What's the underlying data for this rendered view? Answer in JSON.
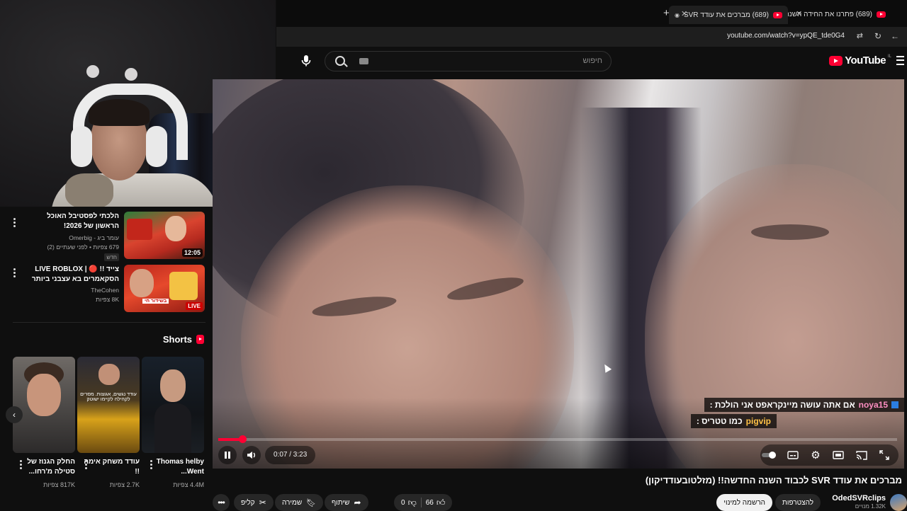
{
  "browser": {
    "tabs": [
      {
        "label": "(689) פתרנו את החידה השנתית"
      },
      {
        "label": "(689) מברכים את עודד SVR"
      }
    ],
    "url": "youtube.com/watch?v=ypQE_tde0G4"
  },
  "masthead": {
    "logo_text": "YouTube",
    "logo_sup": "IL",
    "search_placeholder": "חיפוש"
  },
  "player": {
    "time": "0:07 / 3:23",
    "progress": 0.036,
    "chat": [
      {
        "user": "noya15",
        "text": "אם אתה עושה מיינקראפט אני הולכת :"
      },
      {
        "user": "pigvip",
        "text": "כמו טטריס :"
      }
    ]
  },
  "video": {
    "title": "מברכים את עודד SVR לכבוד השנה החדשה!! (מזלטובעודדיקון)",
    "channel": "OdedSVRclips",
    "subscribers": "1.32K מנויים",
    "join_label": "להצטרפות",
    "subscribe_label": "הרשמה למינוי",
    "likes": "66",
    "dislikes": "0",
    "share_label": "שיתוף",
    "save_label": "שמירה",
    "clip_label": "קליפ"
  },
  "sidebar": {
    "recommendations": [
      {
        "title": "הלכתי לפסטיבל האוכל הראשון של 2026!",
        "channel": "עומר ביג - Omerbig",
        "meta": "679 צפיות • לפני שעתיים (2)",
        "badge": "חדש",
        "duration": "12:05"
      },
      {
        "title": "צייד !! 🔴 | LIVE ROBLOX הסקאמרים בא עצבני ביותר",
        "channel": "TheCohen",
        "meta": "8K צפיות",
        "live_label": "LIVE",
        "thumb_text": "בשידור חי"
      }
    ],
    "shorts_label": "Shorts",
    "shorts": [
      {
        "title": "Thomas helby Went...",
        "views": "4.4M צפיות"
      },
      {
        "title": "עודד משחק אימה !!",
        "views": "2.7K צפיות"
      },
      {
        "title": "החלק הגנוז של סטילה מ'רחו...",
        "views": "817K צפיות"
      }
    ],
    "short_caption": "עודד נגשים, אגוצות. מסרים לקהילה לקיימו ישוטק"
  },
  "colors": {
    "accent": "#ff0033",
    "chat_user": "#ff8fc2",
    "chat_user_gold": "#ffc247",
    "background": "#0f0f0f"
  }
}
